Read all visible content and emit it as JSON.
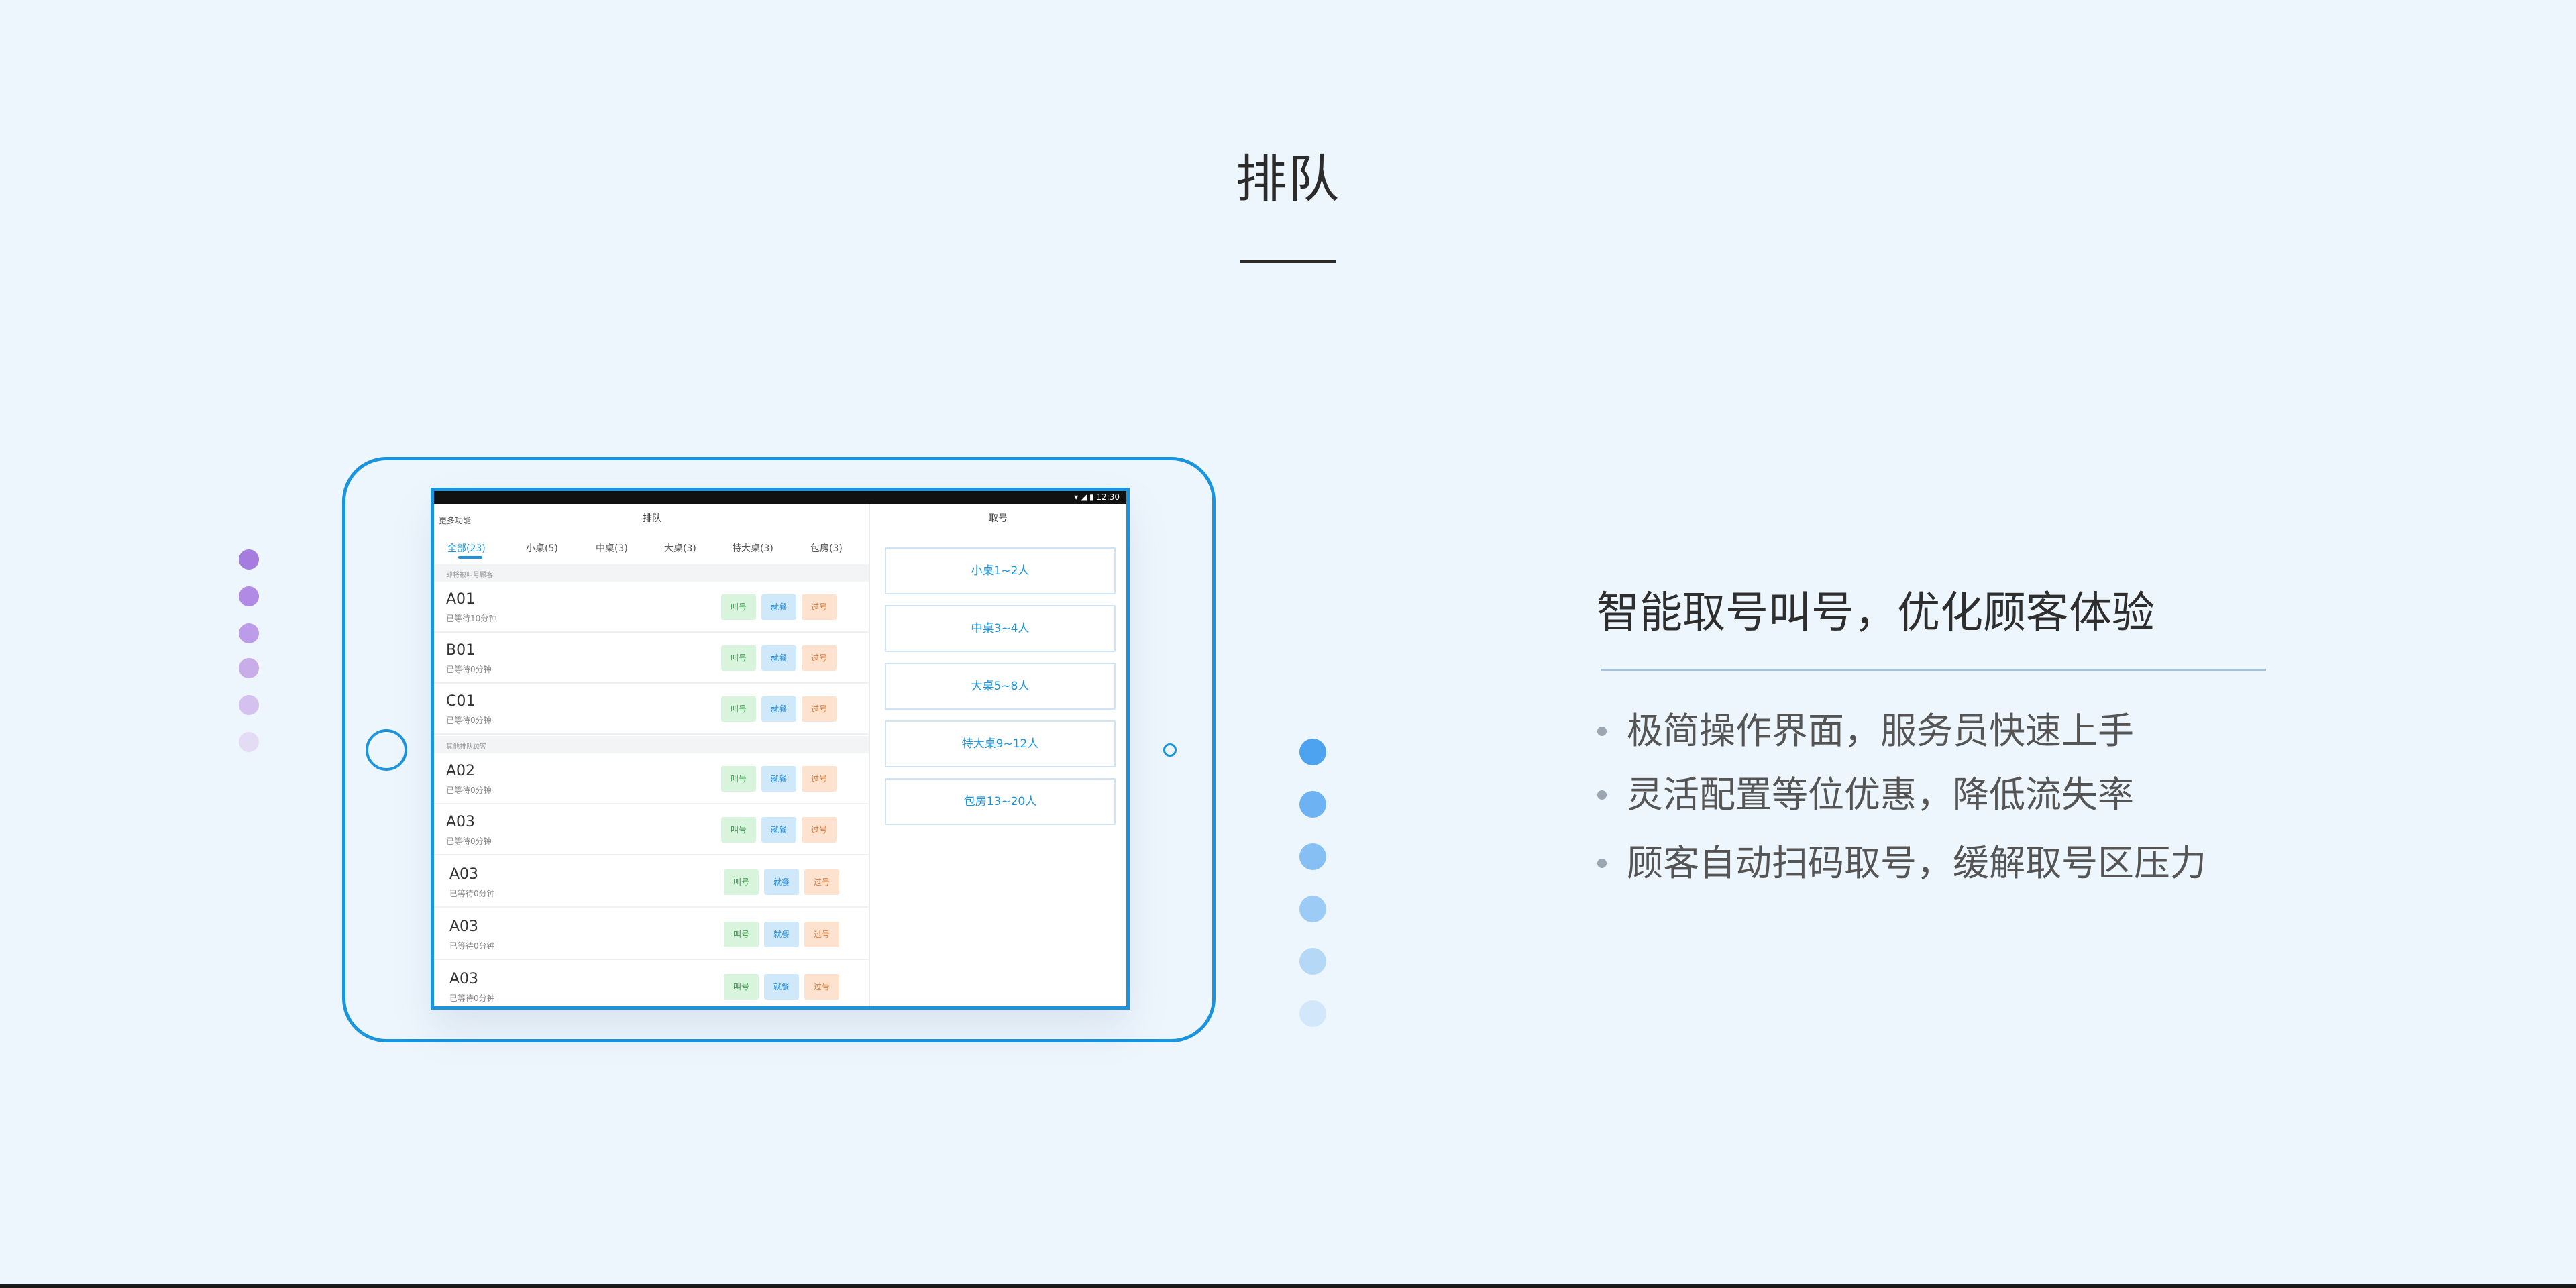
{
  "page_title": "排队",
  "colors": {
    "accent": "#1a94dc",
    "background": "#eef6fd",
    "purple_dot": "#a67ddf",
    "blue_dot": "#4ea3f0"
  },
  "tablet": {
    "top_left": "更多功能",
    "status_time": "12:30",
    "queue_title": "排队",
    "take_title": "取号",
    "tabs": [
      {
        "label": "全部(23)",
        "active": true
      },
      {
        "label": "小桌(5)"
      },
      {
        "label": "中桌(3)"
      },
      {
        "label": "大桌(3)"
      },
      {
        "label": "特大桌(3)"
      },
      {
        "label": "包房(3)"
      }
    ],
    "section_1": "即将被叫号顾客",
    "section_2": "其他排队顾客",
    "buttons": {
      "call": "叫号",
      "seat": "就餐",
      "pass": "过号"
    },
    "rows_1": [
      {
        "no": "A01",
        "wait": "已等待10分钟"
      },
      {
        "no": "B01",
        "wait": "已等待0分钟"
      },
      {
        "no": "C01",
        "wait": "已等待0分钟"
      }
    ],
    "rows_2": [
      {
        "no": "A02",
        "wait": "已等待0分钟"
      },
      {
        "no": "A03",
        "wait": "已等待0分钟"
      },
      {
        "no": "A03",
        "wait": "已等待0分钟"
      },
      {
        "no": "A03",
        "wait": "已等待0分钟"
      },
      {
        "no": "A03",
        "wait": "已等待0分钟"
      }
    ],
    "take_buttons": [
      "小桌1~2人",
      "中桌3~4人",
      "大桌5~8人",
      "特大桌9~12人",
      "包房13~20人"
    ]
  },
  "feature": {
    "headline": "智能取号叫号，优化顾客体验",
    "bullets": [
      "极简操作界面，服务员快速上手",
      "灵活配置等位优惠，降低流失率",
      "顾客自动扫码取号，缓解取号区压力"
    ]
  }
}
